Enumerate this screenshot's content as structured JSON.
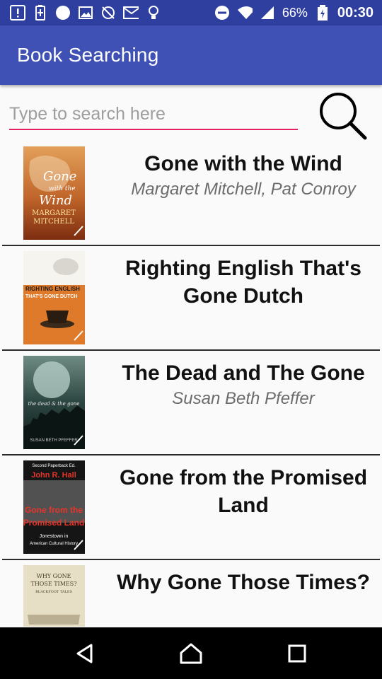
{
  "status_bar": {
    "battery_percent": "66%",
    "time": "00:30",
    "icons": [
      "alert-icon",
      "battery-saver-icon",
      "circle-icon",
      "image-icon",
      "no-sync-icon",
      "email-icon",
      "lightbulb-icon",
      "do-not-disturb-icon",
      "wifi-icon",
      "signal-icon",
      "battery-icon"
    ]
  },
  "app_bar": {
    "title": "Book Searching"
  },
  "search": {
    "placeholder": "Type to search here",
    "value": ""
  },
  "books": [
    {
      "title": "Gone with the Wind",
      "author": "Margaret Mitchell, Pat Conroy",
      "cover_color": "#b4531c"
    },
    {
      "title": "Righting English That's Gone Dutch",
      "author": "",
      "cover_color": "#e07a2b"
    },
    {
      "title": "The Dead and The Gone",
      "author": "Susan Beth Pfeffer",
      "cover_color": "#2f4a46"
    },
    {
      "title": "Gone from the Promised Land",
      "author": "",
      "cover_color": "#c0392b"
    },
    {
      "title": "Why Gone Those Times?",
      "author": "",
      "cover_color": "#e6dfc6"
    }
  ],
  "covers": {
    "gone_wind": {
      "line1": "Gone",
      "line2": "with the",
      "line3": "Wind",
      "author": "MARGARET",
      "author2": "MITCHELL"
    },
    "righting": {
      "line1": "RIGHTING ENGLISH",
      "line2": "THAT'S GONE DUTCH"
    },
    "dead_gone": {
      "line1": "the dead & the gone",
      "author": "SUSAN BETH PFEFFER"
    },
    "promised": {
      "top": "Second Paperback Ed.",
      "author": "John R. Hall",
      "line1": "Gone from the",
      "line2": "Promised Land",
      "line3": "Jonestown in",
      "line4": "American Cultural History"
    },
    "why_gone": {
      "line1": "WHY GONE",
      "line2": "THOSE TIMES?",
      "line3": "BLACKFOOT TALES"
    }
  },
  "nav": {
    "icons": [
      "back-icon",
      "home-icon",
      "recents-icon"
    ]
  }
}
